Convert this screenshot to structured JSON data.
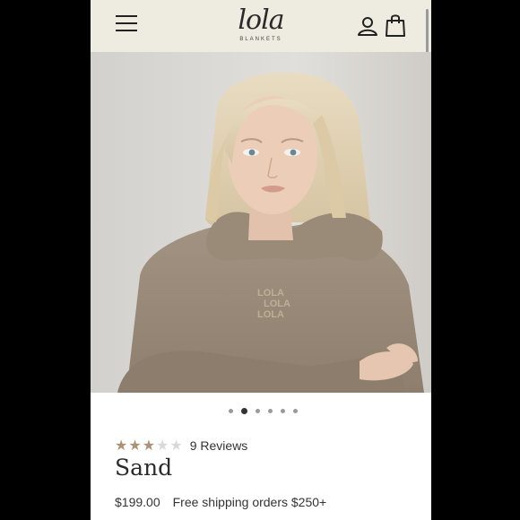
{
  "header": {
    "logo_text": "lola",
    "logo_subtext": "BLANKETS",
    "icons": [
      "menu-icon",
      "account-icon",
      "shopping-bag-icon"
    ]
  },
  "hero": {
    "image_label": "Model wearing sand hoodie",
    "hoodie_print": [
      "LOLA",
      "LOLA",
      "LOLA"
    ]
  },
  "carousel": {
    "total_slides": 6,
    "active_index": 1
  },
  "product": {
    "rating_stars": 3,
    "rating_max": 5,
    "reviews_label": "9 Reviews",
    "title": "Sand",
    "price": "$199.00",
    "shipping_note": "Free shipping orders $250+"
  },
  "colors": {
    "header_bg": "#eeebe0",
    "star_color": "#ad9177",
    "hoodie_color": "#9c8b7a"
  }
}
